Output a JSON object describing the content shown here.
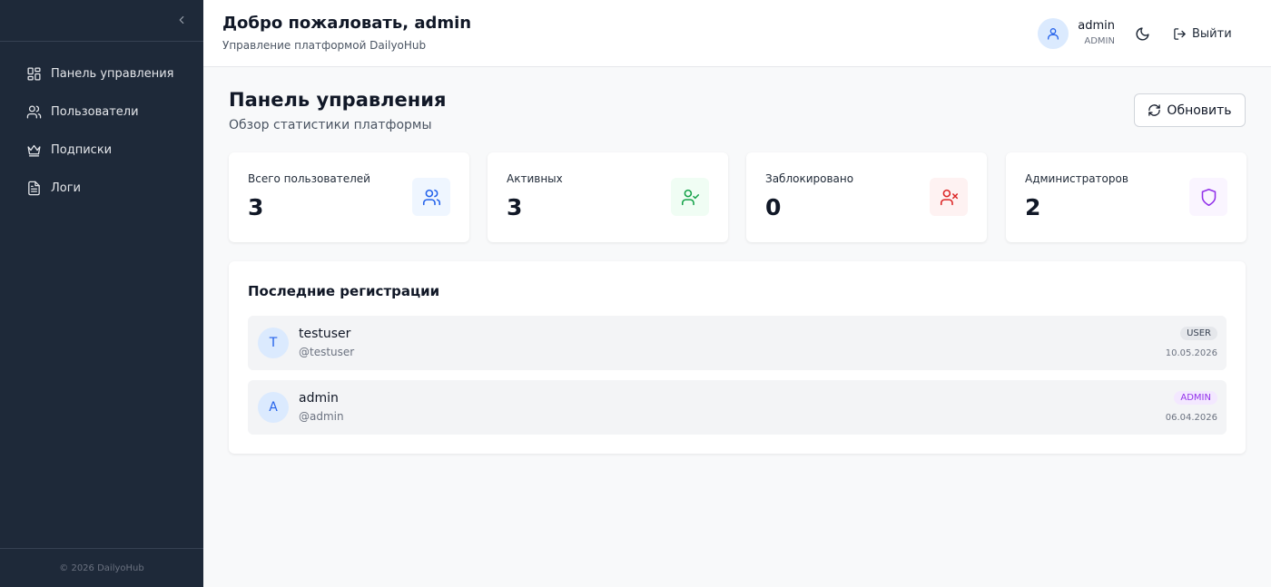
{
  "sidebar": {
    "items": [
      {
        "label": "Панель управления",
        "icon": "dashboard-icon"
      },
      {
        "label": "Пользователи",
        "icon": "users-icon"
      },
      {
        "label": "Подписки",
        "icon": "crown-icon"
      },
      {
        "label": "Логи",
        "icon": "file-text-icon"
      }
    ],
    "footer": "© 2026 DailyoHub"
  },
  "header": {
    "title": "Добро пожаловать, admin",
    "subtitle": "Управление платформой DailyoHub",
    "user": {
      "name": "admin",
      "role": "ADMIN"
    },
    "logout_label": "Выйти"
  },
  "page": {
    "title": "Панель управления",
    "subtitle": "Обзор статистики платформы",
    "refresh_label": "Обновить"
  },
  "stats": [
    {
      "label": "Всего пользователей",
      "value": "3",
      "icon": "users-icon",
      "color": "#2563eb",
      "bg": "#eff6ff"
    },
    {
      "label": "Активных",
      "value": "3",
      "icon": "user-check-icon",
      "color": "#16a34a",
      "bg": "#f0fdf4"
    },
    {
      "label": "Заблокировано",
      "value": "0",
      "icon": "user-x-icon",
      "color": "#dc2626",
      "bg": "#fef2f2"
    },
    {
      "label": "Администраторов",
      "value": "2",
      "icon": "shield-icon",
      "color": "#9333ea",
      "bg": "#faf5ff"
    }
  ],
  "recent": {
    "title": "Последние регистрации",
    "rows": [
      {
        "initial": "T",
        "name": "testuser",
        "handle": "@testuser",
        "role": "USER",
        "date": "10.05.2026"
      },
      {
        "initial": "A",
        "name": "admin",
        "handle": "@admin",
        "role": "ADMIN",
        "date": "06.04.2026"
      }
    ]
  }
}
